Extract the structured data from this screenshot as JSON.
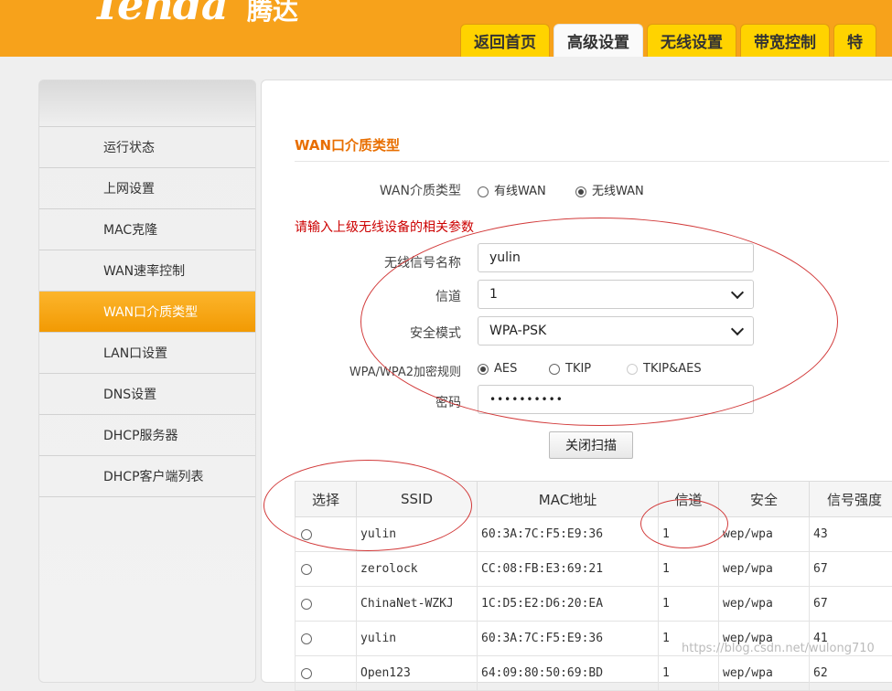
{
  "header": {
    "logo_text": "Tenda",
    "logo_cn": "腾达",
    "tabs": [
      "返回首页",
      "高级设置",
      "无线设置",
      "带宽控制",
      "特"
    ]
  },
  "sidebar": {
    "items": [
      "运行状态",
      "上网设置",
      "MAC克隆",
      "WAN速率控制",
      "WAN口介质类型",
      "LAN口设置",
      "DNS设置",
      "DHCP服务器",
      "DHCP客户端列表"
    ],
    "active": "WAN口介质类型"
  },
  "main": {
    "section_title": "WAN口介质类型",
    "media_type_label": "WAN介质类型",
    "media_options": [
      "有线WAN",
      "无线WAN"
    ],
    "media_selected": "无线WAN",
    "hint": "请输入上级无线设备的相关参数",
    "ssid_label": "无线信号名称",
    "ssid_value": "yulin",
    "channel_label": "信道",
    "channel_value": "1",
    "security_label": "安全模式",
    "security_value": "WPA-PSK",
    "encryption_label": "WPA/WPA2加密规则",
    "encryption_options": [
      "AES",
      "TKIP",
      "TKIP&AES"
    ],
    "encryption_selected": "AES",
    "password_label": "密码",
    "password_value": "••••••••••",
    "scan_button": "关闭扫描"
  },
  "scan_table": {
    "headers": [
      "选择",
      "SSID",
      "MAC地址",
      "信道",
      "安全",
      "信号强度"
    ],
    "rows": [
      [
        "yulin",
        "60:3A:7C:F5:E9:36",
        "1",
        "wep/wpa",
        "43"
      ],
      [
        "zerolock",
        "CC:08:FB:E3:69:21",
        "1",
        "wep/wpa",
        "67"
      ],
      [
        "ChinaNet-WZKJ",
        "1C:D5:E2:D6:20:EA",
        "1",
        "wep/wpa",
        "67"
      ],
      [
        "yulin",
        "60:3A:7C:F5:E9:36",
        "1",
        "wep/wpa",
        "41"
      ],
      [
        "Open123",
        "64:09:80:50:69:BD",
        "1",
        "wep/wpa",
        "62"
      ]
    ]
  },
  "watermark": "https://blog.csdn.net/wulong710",
  "colors": {
    "brand": "#f7a21b",
    "tab": "#ffd300",
    "accent_title": "#e86e00",
    "hint": "#cc0000",
    "annotation": "#d23a3a"
  }
}
